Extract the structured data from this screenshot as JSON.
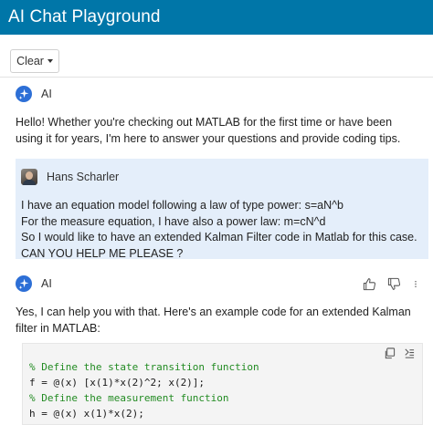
{
  "app": {
    "title": "AI Chat Playground"
  },
  "toolbar": {
    "clear_label": "Clear"
  },
  "messages": [
    {
      "sender": "AI",
      "icon": "ai-sparkle-icon",
      "text": "Hello! Whether you're checking out MATLAB for the first time or have been using it for years, I'm here to answer your questions and provide coding tips."
    },
    {
      "sender": "Hans Scharler",
      "icon": "user-avatar",
      "lines": [
        "I have an equation model following a law of type power: s=aN^b",
        "For the measure equation, I have also a power law: m=cN^d",
        "So I would like to have an extended Kalman Filter code in Matlab for this case. CAN YOU HELP ME PLEASE ?"
      ]
    },
    {
      "sender": "AI",
      "icon": "ai-sparkle-icon",
      "feedback_icons": [
        "thumbs-up-icon",
        "thumbs-down-icon",
        "more-vertical-icon"
      ],
      "text": "Yes, I can help you with that. Here's an example code for an extended Kalman filter in MATLAB:",
      "code_tools": [
        "copy-icon",
        "insert-code-icon"
      ],
      "code": [
        "% Define the state transition function",
        "f = @(x) [x(1)*x(2)^2; x(2)];",
        "% Define the measurement function",
        "h = @(x) x(1)*x(2);"
      ]
    }
  ],
  "colors": {
    "header": "#0076a8",
    "user_bubble": "#e4eefa",
    "code_bg": "#f4f4f4",
    "comment": "#228b22",
    "accent": "#2d6fd6"
  }
}
